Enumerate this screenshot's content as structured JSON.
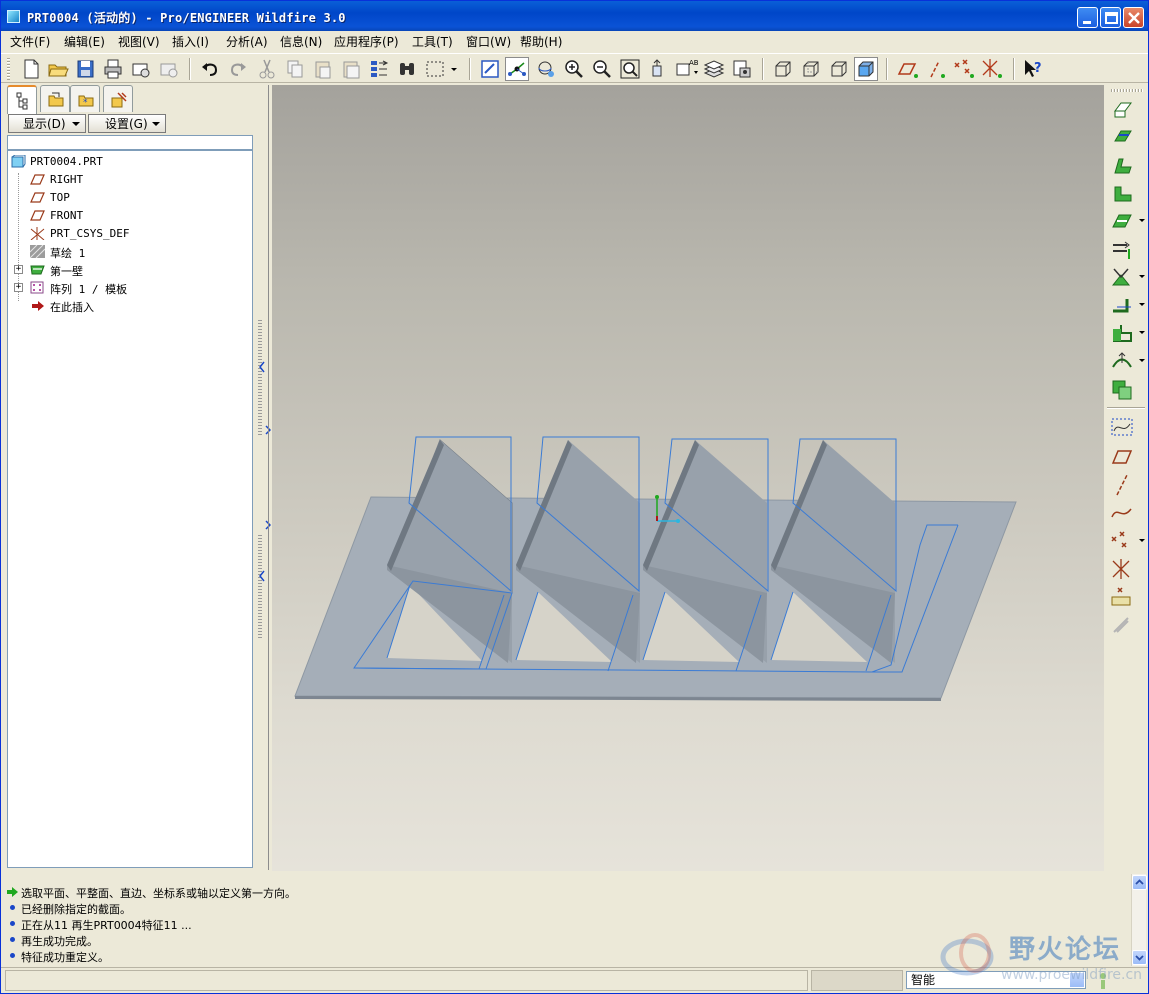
{
  "window": {
    "title": "PRT0004 (活动的) - Pro/ENGINEER Wildfire 3.0"
  },
  "menu": [
    "文件(F)",
    "编辑(E)",
    "视图(V)",
    "插入(I)",
    "分析(A)",
    "信息(N)",
    "应用程序(P)",
    "工具(T)",
    "窗口(W)",
    "帮助(H)"
  ],
  "navigator": {
    "show_button": "显示(D)",
    "settings_button": "设置(G)",
    "tree": [
      {
        "label": "PRT0004.PRT",
        "icon": "part-icon"
      },
      {
        "label": "RIGHT",
        "icon": "datum-plane-icon"
      },
      {
        "label": "TOP",
        "icon": "datum-plane-icon"
      },
      {
        "label": "FRONT",
        "icon": "datum-plane-icon"
      },
      {
        "label": "PRT_CSYS_DEF",
        "icon": "csys-icon"
      },
      {
        "label": "草绘 1",
        "icon": "sketch-icon"
      },
      {
        "label": "第一壁",
        "icon": "sheetmetal-wall-icon"
      },
      {
        "label": "阵列 1 / 模板",
        "icon": "pattern-icon"
      },
      {
        "label": "在此插入",
        "icon": "insert-here-arrow-icon"
      }
    ]
  },
  "messages": [
    {
      "text": "选取平面、平整面、直边、坐标系或轴以定义第一方向。",
      "icon": "prompt-arrow-icon"
    },
    {
      "text": "已经删除指定的截面。",
      "icon": "info-bullet-icon"
    },
    {
      "text": "正在从11 再生PRT0004特征11 ...",
      "icon": "info-bullet-icon"
    },
    {
      "text": "再生成功完成。",
      "icon": "info-bullet-icon"
    },
    {
      "text": "特征成功重定义。",
      "icon": "info-bullet-icon"
    }
  ],
  "status": {
    "filter_value": "智能"
  },
  "watermark": {
    "title": "野火论坛",
    "url": "www.proewildfire.cn"
  },
  "colors": {
    "title_bar": "#0a53d6",
    "model_fill": "#a9b2bc",
    "model_edge": "#3a7bd5",
    "datum_green": "#1fa81f"
  }
}
